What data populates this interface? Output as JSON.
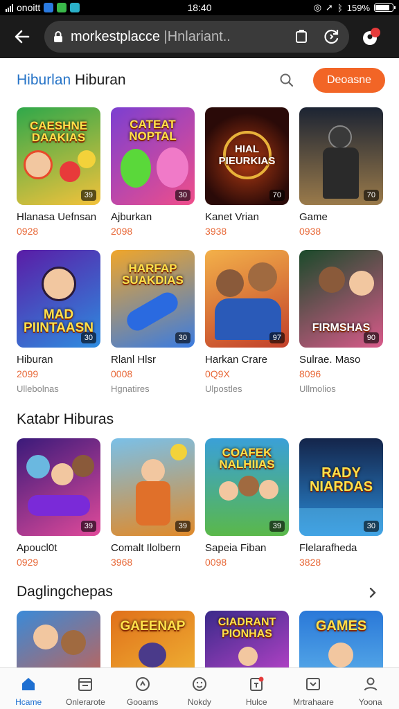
{
  "status_bar": {
    "carrier": "onoitt",
    "time": "18:40",
    "battery": "159%",
    "battery_fraction": 0.85
  },
  "browser": {
    "url_main": "morkestplacce",
    "url_dim": " |Hnlariant..",
    "back_icon": "arrow-left-icon",
    "lock_icon": "lock-icon"
  },
  "header": {
    "brand_blue": "Hiburlan",
    "brand_dark": " Hiburan",
    "cta_label": "Deoasne",
    "accent": "#f26526"
  },
  "row1": [
    {
      "art": "CAESHNE DAAKIAS",
      "badge": "39",
      "name": "Hlanasa Uefnsan",
      "price": "0928",
      "bg": "#2fa84a",
      "bg2": "#f3c23b"
    },
    {
      "art": "CATEAT NOPTAL",
      "badge": "30",
      "name": "Ajburkan",
      "price": "2098",
      "bg": "#7b3fd1",
      "bg2": "#f04e8a"
    },
    {
      "art": "HIAL PIEURKIAS",
      "badge": "70",
      "name": "Kanet Vrian",
      "price": "3938",
      "bg": "#2a0a08",
      "bg2": "#b03a12"
    },
    {
      "art": "",
      "badge": "70",
      "name": "Game",
      "price": "0938",
      "bg": "#1c2433",
      "bg2": "#9a7a4a"
    }
  ],
  "row2": [
    {
      "art": "MAD PIINTAASN",
      "badge": "30",
      "name": "Hiburan",
      "price": "2099",
      "sub": "Ullebolnas",
      "bg": "#5a1ca6",
      "bg2": "#2e8de0"
    },
    {
      "art": "HARFAP SUAKDIAS",
      "badge": "30",
      "name": "Rlanl Hlsr",
      "price": "0008",
      "sub": "Hgnatires",
      "bg": "#f0a62a",
      "bg2": "#3a7be0"
    },
    {
      "art": "",
      "badge": "97",
      "name": "Harkan Crare",
      "price": "0Q9X",
      "sub": "Ulpostles",
      "bg": "#f3b14a",
      "bg2": "#c2402a"
    },
    {
      "art": "FIRMSHAS",
      "badge": "90",
      "name": "Sulrae. Maso",
      "price": "8096",
      "sub": "Ullmolios",
      "bg": "#1a4a2a",
      "bg2": "#d85a8a"
    }
  ],
  "section2_title": "Katabr Hiburas",
  "row3": [
    {
      "art": "",
      "badge": "39",
      "name": "Apoucl0t",
      "price": "0929",
      "bg": "#3a1a7a",
      "bg2": "#e04a9a"
    },
    {
      "art": "",
      "badge": "39",
      "name": "Comalt Ilolbern",
      "price": "3968",
      "bg": "#7ac0e8",
      "bg2": "#e08a2a"
    },
    {
      "art": "COAFEK NALHIIAS",
      "badge": "39",
      "name": "Sapeia Fiban",
      "price": "0098",
      "bg": "#3aa0d8",
      "bg2": "#5ab84a"
    },
    {
      "art": "RADY NIARDAS",
      "badge": "30",
      "name": "Flelarafheda",
      "price": "3828",
      "bg": "#14254a",
      "bg2": "#2a8ad8"
    }
  ],
  "section3_title": "Daglingchepas",
  "row4": [
    {
      "art": "",
      "bg": "#3a8ad8",
      "bg2": "#e05a3a"
    },
    {
      "art": "GAEENAP",
      "bg": "#e0701a",
      "bg2": "#f3c23a"
    },
    {
      "art": "CIADRANT PIONHAS",
      "bg": "#3a2a8a",
      "bg2": "#d84ad8"
    },
    {
      "art": "GAMES",
      "bg": "#2a78d8",
      "bg2": "#6ac0f0"
    }
  ],
  "tabs": [
    {
      "label": "Hcame",
      "icon": "home-icon"
    },
    {
      "label": "Onlerarote",
      "icon": "calendar-icon"
    },
    {
      "label": "Gooams",
      "icon": "game-circle-icon"
    },
    {
      "label": "Nokdy",
      "icon": "smiley-icon"
    },
    {
      "label": "Hulce",
      "icon": "notification-doc-icon"
    },
    {
      "label": "Mrtrahaare",
      "icon": "inbox-icon"
    },
    {
      "label": "Yoona",
      "icon": "person-icon"
    }
  ]
}
